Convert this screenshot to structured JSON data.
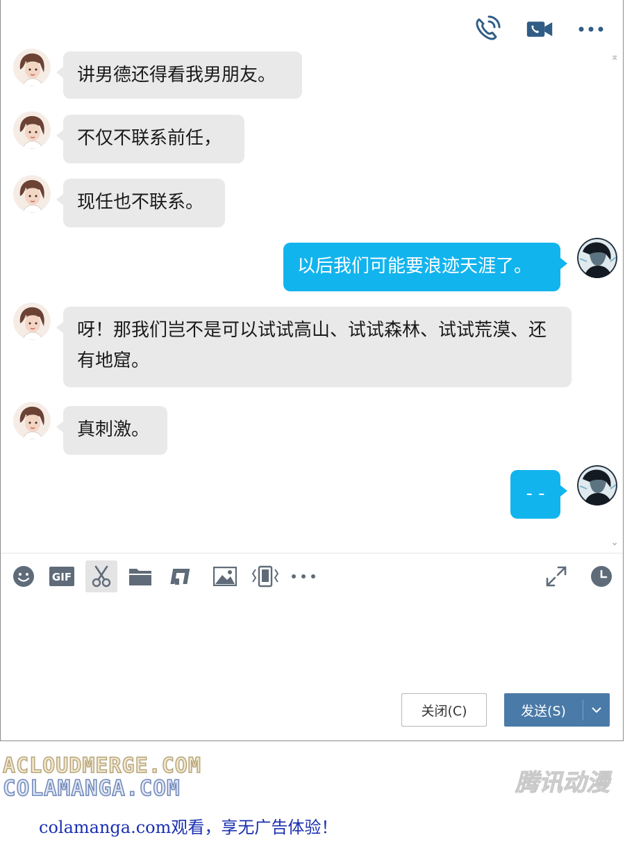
{
  "messages": [
    {
      "side": "left",
      "text": "讲男德还得看我男朋友。"
    },
    {
      "side": "left",
      "text": "不仅不联系前任，"
    },
    {
      "side": "left",
      "text": "现任也不联系。"
    },
    {
      "side": "right",
      "text": "以后我们可能要浪迹天涯了。"
    },
    {
      "side": "left",
      "text": "呀！那我们岂不是可以试试高山、试试森林、试试荒漠、还有地窟。"
    },
    {
      "side": "left",
      "text": "真刺激。"
    },
    {
      "side": "right",
      "text": "- -"
    }
  ],
  "toolbar": {
    "gif_label": "GIF"
  },
  "buttons": {
    "close_label": "关闭(C)",
    "send_label": "发送(S)"
  },
  "watermarks": {
    "line1": "ACLOUDMERGE.COM",
    "line2": "COLAMANGA.COM",
    "brand": "腾讯动漫",
    "promo": "colamanga.com观看，享无广告体验！"
  },
  "colors": {
    "accent": "#12b4ee",
    "send_button": "#4a7aa8",
    "icon": "#2f5d86",
    "bubble_left": "#e9e9e9"
  }
}
